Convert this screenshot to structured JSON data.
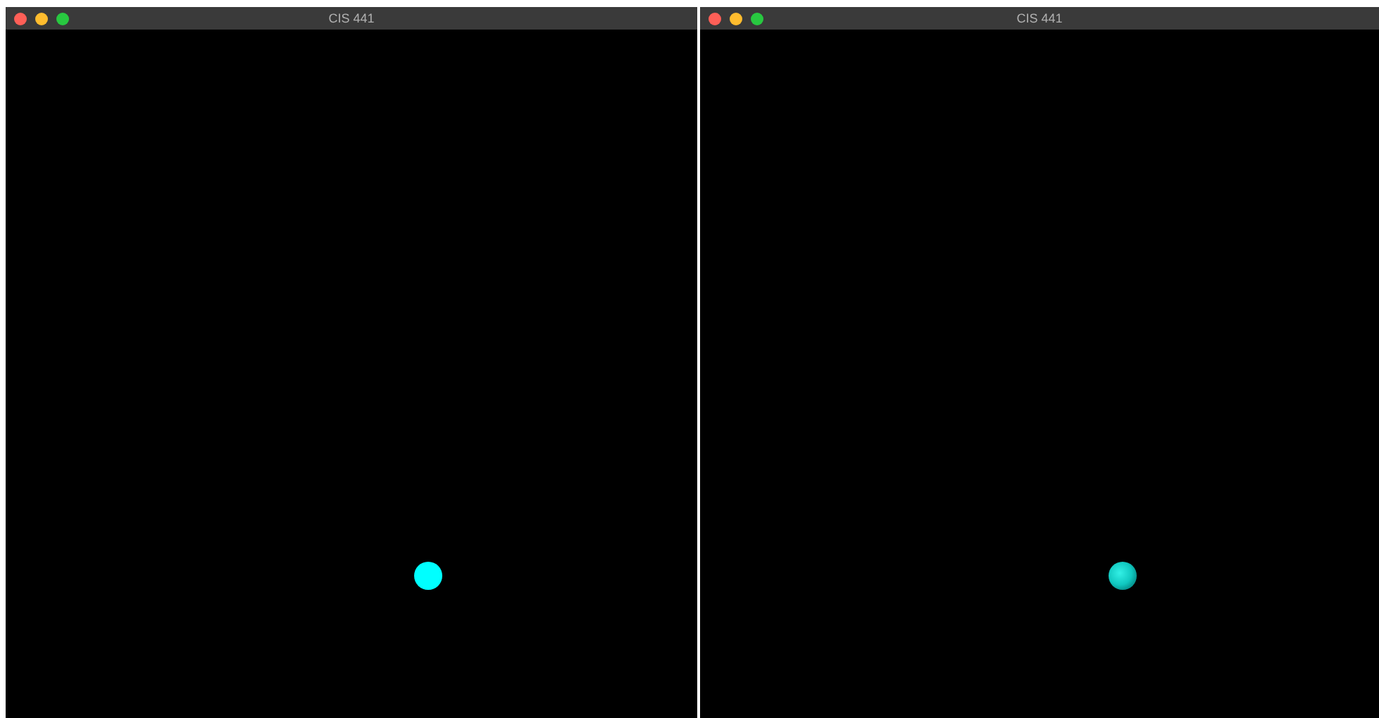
{
  "windows": [
    {
      "title": "CIS 441",
      "scene": {
        "kind": "flat"
      }
    },
    {
      "title": "CIS 441",
      "scene": {
        "kind": "shaded"
      }
    }
  ]
}
